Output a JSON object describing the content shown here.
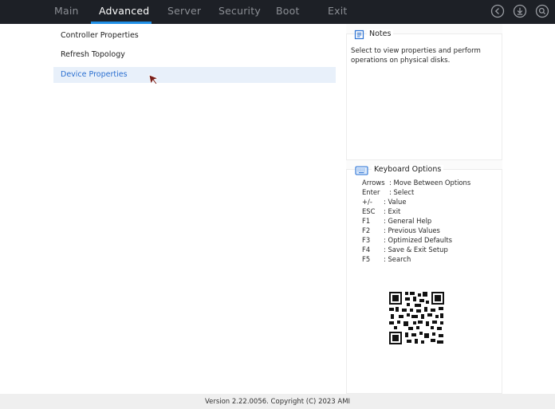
{
  "nav": {
    "tabs": [
      "Main",
      "Advanced",
      "Server",
      "Security",
      "Boot",
      "Exit"
    ],
    "active": "Advanced",
    "icons": [
      "back-icon",
      "download-icon",
      "search-icon"
    ]
  },
  "menu": {
    "items": [
      "Controller Properties",
      "Refresh Topology",
      "Device Properties"
    ],
    "selected": "Device Properties"
  },
  "notes": {
    "title": "Notes",
    "text": "Select to view properties and perform operations on physical disks."
  },
  "keyboard": {
    "title": "Keyboard Options",
    "options": [
      {
        "key": "Arrows",
        "desc": ": Move Between Options"
      },
      {
        "key": "Enter",
        "desc": ": Select"
      },
      {
        "key": "+/-",
        "desc": ": Value"
      },
      {
        "key": "ESC",
        "desc": ": Exit"
      },
      {
        "key": "F1",
        "desc": ": General Help"
      },
      {
        "key": "F2",
        "desc": ": Previous Values"
      },
      {
        "key": "F3",
        "desc": ": Optimized Defaults"
      },
      {
        "key": "F4",
        "desc": ": Save & Exit Setup"
      },
      {
        "key": "F5",
        "desc": ": Search"
      }
    ]
  },
  "footer": {
    "text": "Version 2.22.0056. Copyright (C) 2023 AMI"
  },
  "colors": {
    "topbar": "#1d2026",
    "accent": "#1f8fe6",
    "selected_bg": "#e8f0fa",
    "selected_text": "#2a6fd0"
  }
}
